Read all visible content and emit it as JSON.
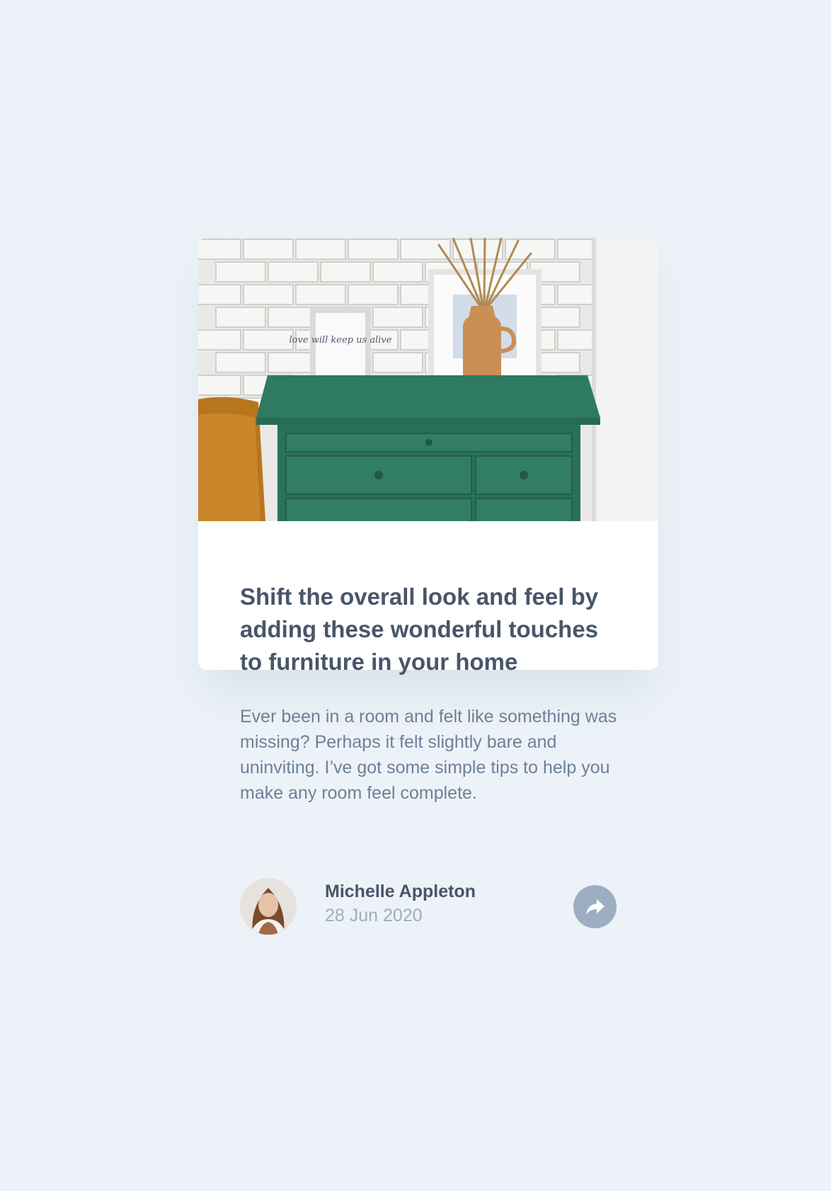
{
  "article": {
    "image_alt": "Green wooden drawer with picture frames and a vase on top",
    "headline": "Shift the overall look and feel by adding these wonderful touches to furniture in your home",
    "excerpt": "Ever been in a room and felt like something was missing? Perhaps it felt slightly bare and uninviting. I’ve got some simple tips to help you make any room feel complete.",
    "frame_text": "love will keep us alive"
  },
  "author": {
    "name": "Michelle Appleton",
    "date": "28 Jun 2020"
  },
  "share": {
    "icon": "share-icon"
  },
  "colors": {
    "background": "#ECF2F8",
    "card": "#FFFFFF",
    "heading": "#48556A",
    "body_text": "#6E8098",
    "muted": "#9DAEC2",
    "drawer_green": "#2F7A62"
  }
}
